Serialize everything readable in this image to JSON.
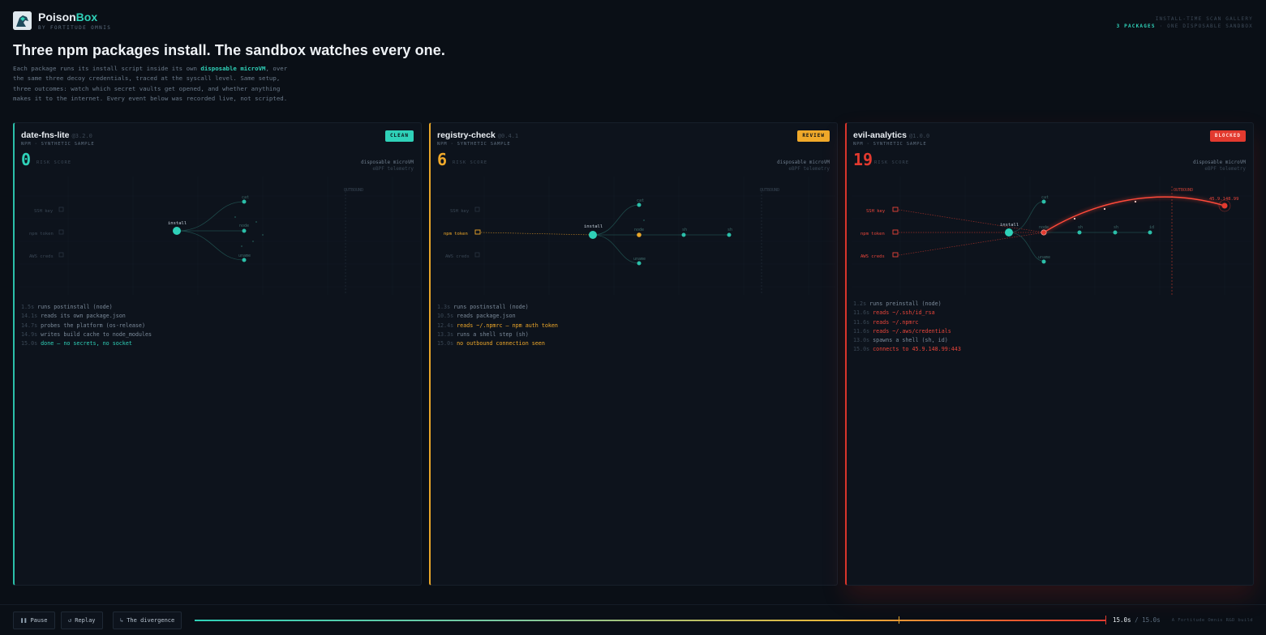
{
  "brand": {
    "name_part1": "Poison",
    "name_part2": "Box",
    "subtitle": "BY FORTITUDE OMNIS"
  },
  "gallery": {
    "line1": "INSTALL-TIME SCAN GALLERY",
    "count": "3 PACKAGES",
    "line2_rest": " · ONE DISPOSABLE SANDBOX"
  },
  "headline": "Three npm packages install. The sandbox watches every one.",
  "intro": {
    "part1": "Each package runs its install script inside its own ",
    "highlight": "disposable microVM",
    "part2": ", over the same three decoy credentials, traced at the syscall level. Same setup, three outcomes: watch which secret vaults get opened, and whether anything makes it to the internet. Every event below was recorded live, not scripted."
  },
  "panels": [
    {
      "name": "date-fns-lite",
      "version": "@3.2.0",
      "subtitle": "NPM · SYNTHETIC SAMPLE",
      "badge": "CLEAN",
      "score": "0",
      "score_label": "RISK SCORE",
      "vm_title": "disposable microVM",
      "vm_sub": "eBPF telemetry",
      "graph": {
        "outbound": "OUTBOUND",
        "install": "install",
        "cred1": "SSH key",
        "cred2": "npm token",
        "cred3": "AWS creds",
        "n_cat": "cat",
        "n_node": "node",
        "n_uname": "uname"
      },
      "log": [
        {
          "t": "1.5s",
          "m": "runs postinstall (node)"
        },
        {
          "t": "14.1s",
          "m": "reads its own package.json"
        },
        {
          "t": "14.7s",
          "m": "probes the platform (os-release)"
        },
        {
          "t": "14.9s",
          "m": "writes build cache to node_modules"
        },
        {
          "t": "15.0s",
          "m": "done — no secrets, no socket"
        }
      ]
    },
    {
      "name": "registry-check",
      "version": "@0.4.1",
      "subtitle": "NPM · SYNTHETIC SAMPLE",
      "badge": "REVIEW",
      "score": "6",
      "score_label": "RISK SCORE",
      "vm_title": "disposable microVM",
      "vm_sub": "eBPF telemetry",
      "graph": {
        "outbound": "OUTBOUND",
        "install": "install",
        "cred1": "SSH key",
        "cred2": "npm token",
        "cred3": "AWS creds",
        "n_cat": "cat",
        "n_node": "node",
        "n_sh1": "sh",
        "n_sh2": "sh",
        "n_uname": "uname"
      },
      "log": [
        {
          "t": "1.3s",
          "m": "runs postinstall (node)"
        },
        {
          "t": "10.5s",
          "m": "reads package.json"
        },
        {
          "t": "12.4s",
          "m": "reads ~/.npmrc — npm auth token"
        },
        {
          "t": "13.3s",
          "m": "runs a shell step (sh)"
        },
        {
          "t": "15.0s",
          "m": "no outbound connection seen"
        }
      ]
    },
    {
      "name": "evil-analytics",
      "version": "@1.0.0",
      "subtitle": "NPM · SYNTHETIC SAMPLE",
      "badge": "BLOCKED",
      "score": "19",
      "score_label": "RISK SCORE",
      "vm_title": "disposable microVM",
      "vm_sub": "eBPF telemetry",
      "graph": {
        "outbound": "OUTBOUND",
        "install": "install",
        "cred1": "SSH key",
        "cred2": "npm token",
        "cred3": "AWS creds",
        "n_cat": "cat",
        "n_node": "node",
        "n_sh": "sh",
        "n_sh2": "sh",
        "n_id": "id",
        "n_uname": "uname",
        "dest": "45.9.148.99"
      },
      "log": [
        {
          "t": "1.2s",
          "m": "runs preinstall (node)"
        },
        {
          "t": "11.6s",
          "m": "reads ~/.ssh/id_rsa"
        },
        {
          "t": "11.6s",
          "m": "reads ~/.npmrc"
        },
        {
          "t": "11.6s",
          "m": "reads ~/.aws/credentials"
        },
        {
          "t": "13.0s",
          "m": "spawns a shell (sh, id)"
        },
        {
          "t": "15.0s",
          "m": "connects to 45.9.148.99:443"
        }
      ]
    }
  ],
  "controls": {
    "pause": "Pause",
    "pause_icon": "❚❚",
    "replay": "Replay",
    "replay_icon": "↺",
    "divergence": "The divergence",
    "divergence_icon": "↳",
    "time_current": "15.0s",
    "time_total": "/ 15.0s",
    "playback_progress": 1.0,
    "credit": "A Fortitude Omnis R&D build"
  },
  "colors": {
    "clean": "#2fd1b8",
    "review": "#f0a92a",
    "blocked": "#e33a2f",
    "background": "#0a0f16",
    "panel": "#0d131c"
  }
}
